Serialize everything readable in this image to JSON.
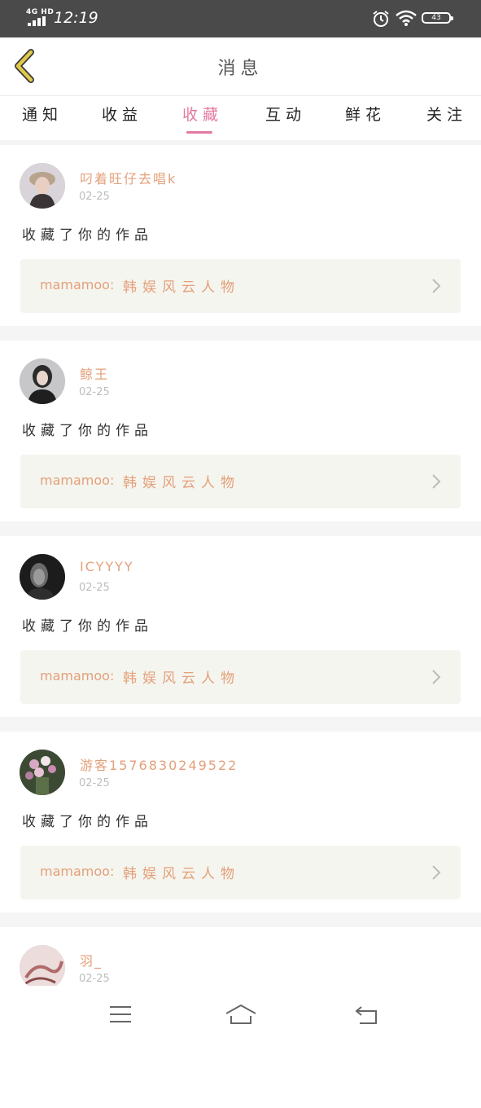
{
  "status_bar": {
    "network": "4G HD",
    "time": "12:19",
    "battery": "43"
  },
  "header": {
    "title": "消息",
    "back_icon": "chevron-left-icon",
    "accent_color": "#e0c84a"
  },
  "tabs": [
    {
      "label": "通知",
      "active": false
    },
    {
      "label": "收益",
      "active": false
    },
    {
      "label": "收藏",
      "active": true
    },
    {
      "label": "互动",
      "active": false
    },
    {
      "label": "鲜花",
      "active": false
    },
    {
      "label": "关注",
      "active": false
    }
  ],
  "colors": {
    "accent_pink": "#e37aa2",
    "username_orange": "#e3a07a",
    "card_bg": "#f5f5ef"
  },
  "notifications": [
    {
      "username": "叼着旺仔去唱k",
      "date": "02-25",
      "action": "收藏了你的作品",
      "work_prefix": "mamamoo:",
      "work_title": "韩娱风云人物"
    },
    {
      "username": "鲸王",
      "date": "02-25",
      "action": "收藏了你的作品",
      "work_prefix": "mamamoo:",
      "work_title": "韩娱风云人物"
    },
    {
      "username": "ICYYYY",
      "date": "02-25",
      "action": "收藏了你的作品",
      "work_prefix": "mamamoo:",
      "work_title": "韩娱风云人物"
    },
    {
      "username": "游客1576830249522",
      "date": "02-25",
      "action": "收藏了你的作品",
      "work_prefix": "mamamoo:",
      "work_title": "韩娱风云人物"
    },
    {
      "username": "羽_",
      "date": "02-25"
    }
  ],
  "nav_bar": {
    "menu_icon": "menu-icon",
    "home_icon": "home-icon",
    "back_icon": "return-icon"
  }
}
